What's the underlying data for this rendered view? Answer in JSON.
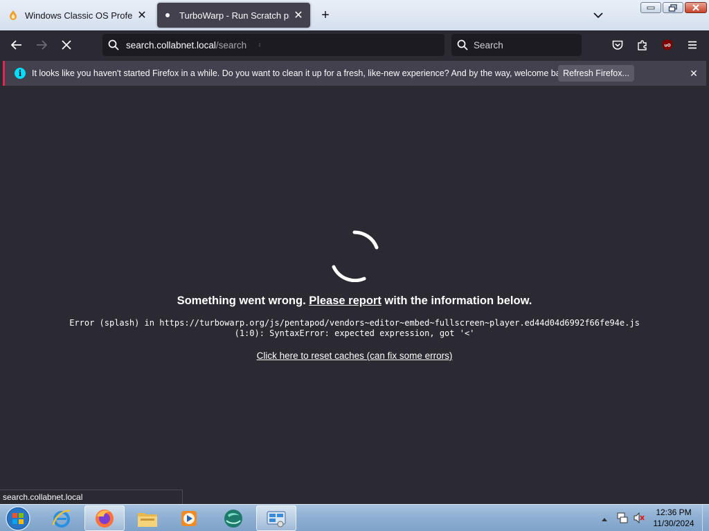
{
  "tabs": [
    {
      "title": "Windows Classic OS Profession",
      "icon": "windows-classic-favicon"
    },
    {
      "title": "TurboWarp - Run Scratch proje",
      "icon": "turbowarp-favicon"
    }
  ],
  "url": {
    "host": "search.collabnet.local",
    "path": "/search"
  },
  "search": {
    "placeholder": "Search"
  },
  "notification": {
    "message": "It looks like you haven't started Firefox in a while. Do you want to clean it up for a fresh, like-new experience? And by the way, welcome back!",
    "button": "Refresh Firefox..."
  },
  "error": {
    "title_prefix": "Something went wrong.",
    "report_link": "Please report",
    "title_suffix": "with the information below.",
    "detail_line1": "Error (splash) in https://turbowarp.org/js/pentapod/vendors~editor~embed~fullscreen~player.ed44d04d6992f66fe94e.js",
    "detail_line2": "(1:0): SyntaxError: expected expression, got '<'",
    "reset_link": "Click here to reset caches (can fix some errors)"
  },
  "status_text": "search.collabnet.local",
  "taskbar": {
    "items": [
      "internet-explorer-icon",
      "firefox-icon",
      "file-explorer-icon",
      "media-player-icon",
      "browser-globe-icon",
      "control-panel-icon"
    ],
    "time": "12:36 PM",
    "date": "11/30/2024"
  },
  "colors": {
    "accent": "#00ddff",
    "notification_border": "#e22850",
    "page_bg": "#2b2a33"
  }
}
